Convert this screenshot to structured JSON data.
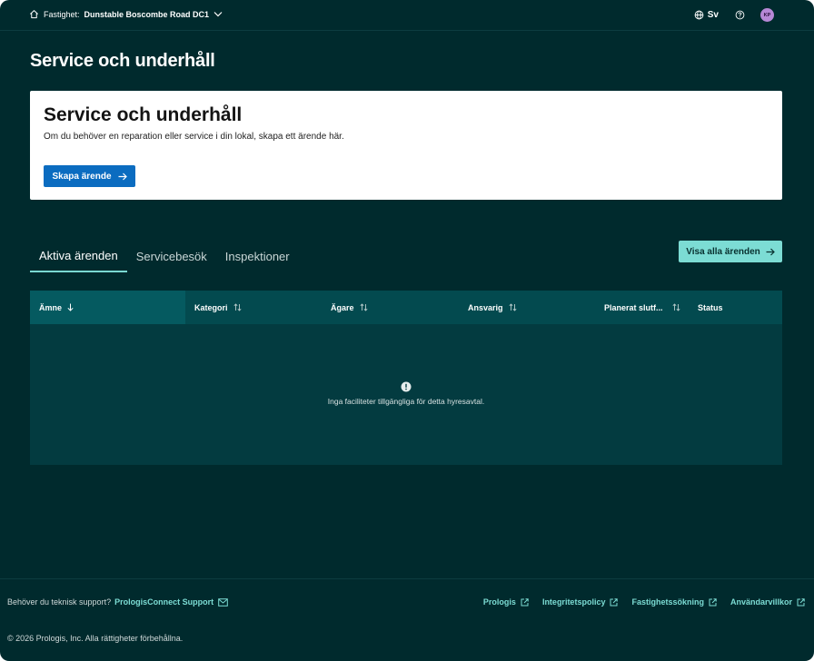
{
  "header": {
    "property_label": "Fastighet:",
    "property_name": "Dunstable Boscombe Road DC1",
    "language": "Sv",
    "avatar_initials": "KP"
  },
  "page": {
    "title": "Service och underhåll"
  },
  "card": {
    "title": "Service och underhåll",
    "description": "Om du behöver en reparation eller service i din lokal, skapa ett ärende här.",
    "create_button": "Skapa ärende"
  },
  "tabs": [
    {
      "label": "Aktiva ärenden",
      "active": true
    },
    {
      "label": "Servicebesök",
      "active": false
    },
    {
      "label": "Inspektioner",
      "active": false
    }
  ],
  "view_all_button": "Visa alla ärenden",
  "table": {
    "columns": [
      {
        "label": "Ämne",
        "sort": "desc"
      },
      {
        "label": "Kategori",
        "sort": "none"
      },
      {
        "label": "Ägare",
        "sort": "none"
      },
      {
        "label": "Ansvarig",
        "sort": "none"
      },
      {
        "label": "Planerat slutf...",
        "sort": "none"
      },
      {
        "label": "Status",
        "sort": "none"
      }
    ],
    "empty_message": "Inga faciliteter tillgängliga för detta hyresavtal."
  },
  "footer": {
    "support_text": "Behöver du teknisk support?",
    "support_link": "PrologisConnect Support",
    "links": [
      "Prologis",
      "Integritetspolicy",
      "Fastighetssökning",
      "Användarvillkor"
    ],
    "copyright": "© 2026 Prologis, Inc. Alla rättigheter förbehållna."
  },
  "colors": {
    "background": "#002a2d",
    "primary_button": "#0b6cc0",
    "accent": "#7cdcd4",
    "table_header": "#034a4f",
    "table_body": "#033b40"
  }
}
